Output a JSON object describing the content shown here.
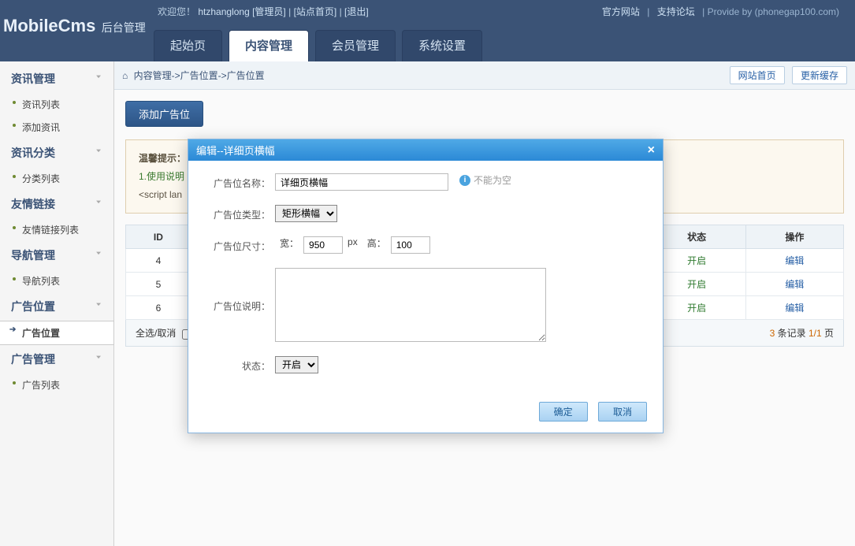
{
  "topbar": {
    "welcome_prefix": "欢迎您！",
    "user": "htzhanglong",
    "role": "[管理员]",
    "site_home": "[站点首页]",
    "logout": "[退出]",
    "right": {
      "official": "官方网站",
      "forum": "支持论坛",
      "provide": "Provide by (phonegap100.com)"
    },
    "logo_big": "MobileCms",
    "logo_small": "后台管理",
    "tabs": [
      {
        "label": "起始页",
        "active": false
      },
      {
        "label": "内容管理",
        "active": true
      },
      {
        "label": "会员管理",
        "active": false
      },
      {
        "label": "系统设置",
        "active": false
      }
    ]
  },
  "sidebar": [
    {
      "title": "资讯管理",
      "items": [
        "资讯列表",
        "添加资讯"
      ]
    },
    {
      "title": "资讯分类",
      "items": [
        "分类列表"
      ]
    },
    {
      "title": "友情链接",
      "items": [
        "友情链接列表"
      ]
    },
    {
      "title": "导航管理",
      "items": [
        "导航列表"
      ]
    },
    {
      "title": "广告位置",
      "items": [
        "广告位置"
      ],
      "active_item": 0
    },
    {
      "title": "广告管理",
      "items": [
        "广告列表"
      ]
    }
  ],
  "breadcrumb": {
    "path": "内容管理->广告位置->广告位置",
    "links": {
      "site_home": "网站首页",
      "refresh": "更新缓存"
    }
  },
  "page": {
    "add_button": "添加广告位",
    "tip_title": "温馨提示：",
    "tip_line1": "1.使用说明",
    "tip_line2": "<script lan",
    "table": {
      "headers": {
        "id": "ID",
        "status": "状态",
        "action": "操作"
      },
      "rows": [
        {
          "id": "4",
          "status": "开启",
          "action": "编辑"
        },
        {
          "id": "5",
          "status": "开启",
          "action": "编辑"
        },
        {
          "id": "6",
          "status": "开启",
          "action": "编辑"
        }
      ]
    },
    "footer": {
      "select_all": "全选/取消",
      "count_a": "3",
      "count_b": " 条记录 ",
      "page": "1/1",
      "page_suffix": " 页"
    }
  },
  "modal": {
    "title": "编辑--详细页横幅",
    "fields": {
      "name_label": "广告位名称：",
      "name_value": "详细页横幅",
      "name_hint": "不能为空",
      "type_label": "广告位类型：",
      "type_value": "矩形横幅",
      "size_label": "广告位尺寸：",
      "width_label": "宽：",
      "width_value": "950",
      "px": "px",
      "height_label": "高：",
      "height_value": "100",
      "desc_label": "广告位说明：",
      "status_label": "状态：",
      "status_value": "开启"
    },
    "buttons": {
      "ok": "确定",
      "cancel": "取消"
    }
  }
}
